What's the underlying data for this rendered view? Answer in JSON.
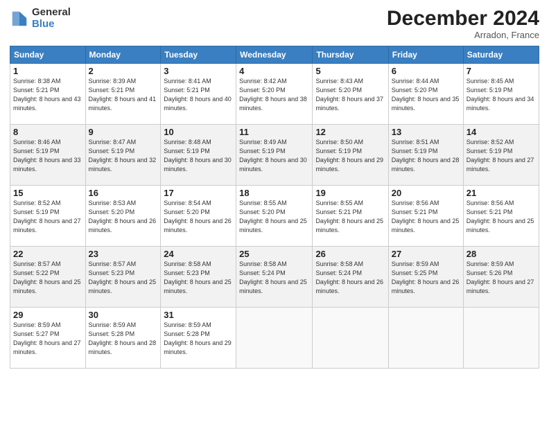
{
  "logo": {
    "general": "General",
    "blue": "Blue"
  },
  "title": "December 2024",
  "location": "Arradon, France",
  "days_of_week": [
    "Sunday",
    "Monday",
    "Tuesday",
    "Wednesday",
    "Thursday",
    "Friday",
    "Saturday"
  ],
  "weeks": [
    [
      {
        "day": "1",
        "sunrise": "8:38 AM",
        "sunset": "5:21 PM",
        "daylight": "8 hours and 43 minutes."
      },
      {
        "day": "2",
        "sunrise": "8:39 AM",
        "sunset": "5:21 PM",
        "daylight": "8 hours and 41 minutes."
      },
      {
        "day": "3",
        "sunrise": "8:41 AM",
        "sunset": "5:21 PM",
        "daylight": "8 hours and 40 minutes."
      },
      {
        "day": "4",
        "sunrise": "8:42 AM",
        "sunset": "5:20 PM",
        "daylight": "8 hours and 38 minutes."
      },
      {
        "day": "5",
        "sunrise": "8:43 AM",
        "sunset": "5:20 PM",
        "daylight": "8 hours and 37 minutes."
      },
      {
        "day": "6",
        "sunrise": "8:44 AM",
        "sunset": "5:20 PM",
        "daylight": "8 hours and 35 minutes."
      },
      {
        "day": "7",
        "sunrise": "8:45 AM",
        "sunset": "5:19 PM",
        "daylight": "8 hours and 34 minutes."
      }
    ],
    [
      {
        "day": "8",
        "sunrise": "8:46 AM",
        "sunset": "5:19 PM",
        "daylight": "8 hours and 33 minutes."
      },
      {
        "day": "9",
        "sunrise": "8:47 AM",
        "sunset": "5:19 PM",
        "daylight": "8 hours and 32 minutes."
      },
      {
        "day": "10",
        "sunrise": "8:48 AM",
        "sunset": "5:19 PM",
        "daylight": "8 hours and 30 minutes."
      },
      {
        "day": "11",
        "sunrise": "8:49 AM",
        "sunset": "5:19 PM",
        "daylight": "8 hours and 30 minutes."
      },
      {
        "day": "12",
        "sunrise": "8:50 AM",
        "sunset": "5:19 PM",
        "daylight": "8 hours and 29 minutes."
      },
      {
        "day": "13",
        "sunrise": "8:51 AM",
        "sunset": "5:19 PM",
        "daylight": "8 hours and 28 minutes."
      },
      {
        "day": "14",
        "sunrise": "8:52 AM",
        "sunset": "5:19 PM",
        "daylight": "8 hours and 27 minutes."
      }
    ],
    [
      {
        "day": "15",
        "sunrise": "8:52 AM",
        "sunset": "5:19 PM",
        "daylight": "8 hours and 27 minutes."
      },
      {
        "day": "16",
        "sunrise": "8:53 AM",
        "sunset": "5:20 PM",
        "daylight": "8 hours and 26 minutes."
      },
      {
        "day": "17",
        "sunrise": "8:54 AM",
        "sunset": "5:20 PM",
        "daylight": "8 hours and 26 minutes."
      },
      {
        "day": "18",
        "sunrise": "8:55 AM",
        "sunset": "5:20 PM",
        "daylight": "8 hours and 25 minutes."
      },
      {
        "day": "19",
        "sunrise": "8:55 AM",
        "sunset": "5:21 PM",
        "daylight": "8 hours and 25 minutes."
      },
      {
        "day": "20",
        "sunrise": "8:56 AM",
        "sunset": "5:21 PM",
        "daylight": "8 hours and 25 minutes."
      },
      {
        "day": "21",
        "sunrise": "8:56 AM",
        "sunset": "5:21 PM",
        "daylight": "8 hours and 25 minutes."
      }
    ],
    [
      {
        "day": "22",
        "sunrise": "8:57 AM",
        "sunset": "5:22 PM",
        "daylight": "8 hours and 25 minutes."
      },
      {
        "day": "23",
        "sunrise": "8:57 AM",
        "sunset": "5:23 PM",
        "daylight": "8 hours and 25 minutes."
      },
      {
        "day": "24",
        "sunrise": "8:58 AM",
        "sunset": "5:23 PM",
        "daylight": "8 hours and 25 minutes."
      },
      {
        "day": "25",
        "sunrise": "8:58 AM",
        "sunset": "5:24 PM",
        "daylight": "8 hours and 25 minutes."
      },
      {
        "day": "26",
        "sunrise": "8:58 AM",
        "sunset": "5:24 PM",
        "daylight": "8 hours and 26 minutes."
      },
      {
        "day": "27",
        "sunrise": "8:59 AM",
        "sunset": "5:25 PM",
        "daylight": "8 hours and 26 minutes."
      },
      {
        "day": "28",
        "sunrise": "8:59 AM",
        "sunset": "5:26 PM",
        "daylight": "8 hours and 27 minutes."
      }
    ],
    [
      {
        "day": "29",
        "sunrise": "8:59 AM",
        "sunset": "5:27 PM",
        "daylight": "8 hours and 27 minutes."
      },
      {
        "day": "30",
        "sunrise": "8:59 AM",
        "sunset": "5:28 PM",
        "daylight": "8 hours and 28 minutes."
      },
      {
        "day": "31",
        "sunrise": "8:59 AM",
        "sunset": "5:28 PM",
        "daylight": "8 hours and 29 minutes."
      },
      null,
      null,
      null,
      null
    ]
  ]
}
